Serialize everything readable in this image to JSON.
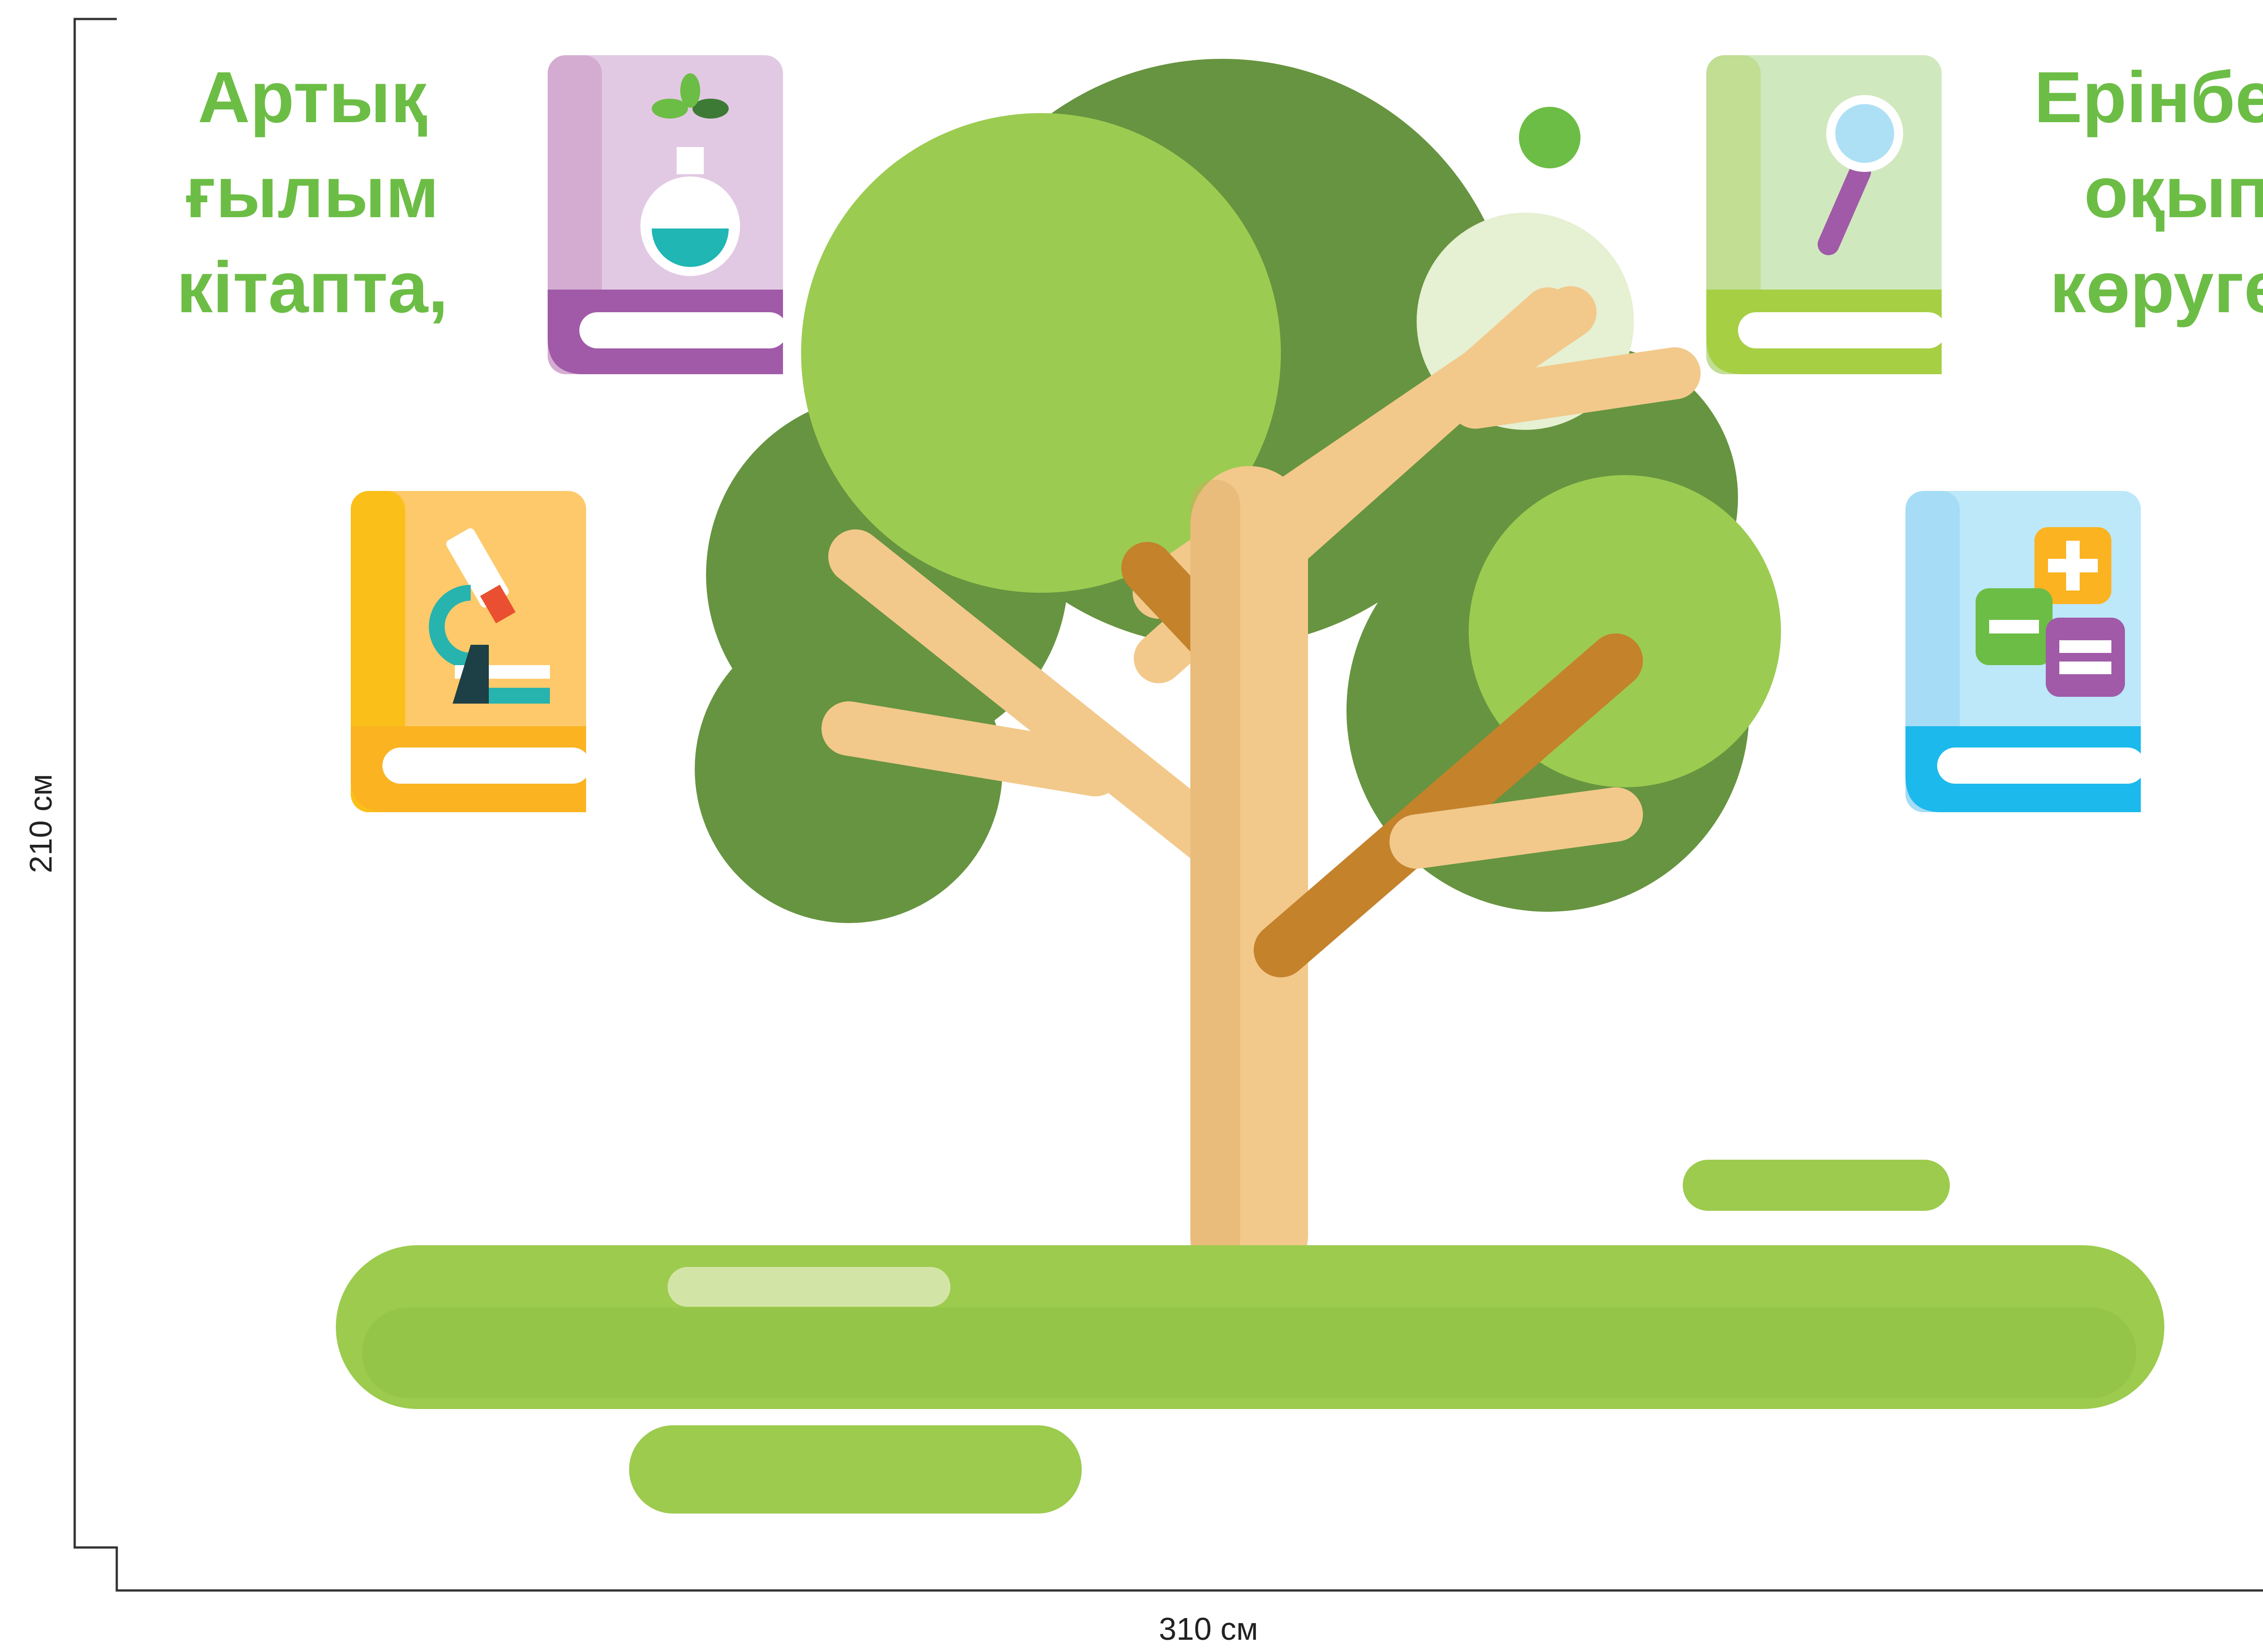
{
  "headline_left": [
    "Артық",
    "ғылым",
    "кітапта,"
  ],
  "headline_right": [
    "Ерінбей",
    "оқып",
    "көруге."
  ],
  "dimensions": {
    "width": "310 см",
    "height": "210 см"
  },
  "colors": {
    "text_green": "#6cbd45",
    "tree_dark": "#679440",
    "tree_light": "#9ccb51",
    "trunk": "#f2c98b",
    "branch_dark": "#c4822b",
    "grass": "#9ccb4e"
  },
  "books": [
    {
      "icon": "chemistry-flask-icon",
      "color": "#a05aa8"
    },
    {
      "icon": "magnifier-icon",
      "color": "#a6cf44"
    },
    {
      "icon": "microscope-icon",
      "color": "#fbb321"
    },
    {
      "icon": "math-operators-icon",
      "color": "#1cb9ec"
    }
  ]
}
